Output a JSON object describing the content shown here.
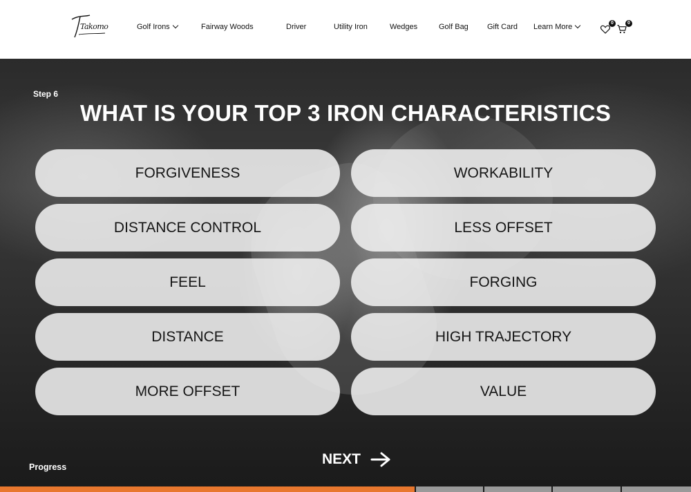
{
  "header": {
    "logo_text": "Takomo",
    "nav": [
      {
        "label": "Golf Irons",
        "dropdown": true
      },
      {
        "label": "Fairway Woods",
        "dropdown": false
      },
      {
        "label": "Driver",
        "dropdown": false
      },
      {
        "label": "Utility Iron",
        "dropdown": false
      },
      {
        "label": "Wedges",
        "dropdown": false
      },
      {
        "label": "Golf Bag",
        "dropdown": false
      },
      {
        "label": "Gift Card",
        "dropdown": false
      },
      {
        "label": "Learn More",
        "dropdown": true
      }
    ],
    "wishlist_count": "0",
    "cart_count": "0"
  },
  "quiz": {
    "step_label": "Step 6",
    "question": "WHAT IS YOUR TOP 3 IRON CHARACTERISTICS",
    "options": [
      "FORGIVENESS",
      "WORKABILITY",
      "DISTANCE CONTROL",
      "LESS OFFSET",
      "FEEL",
      "FORGING",
      "DISTANCE",
      "HIGH TRAJECTORY",
      "MORE OFFSET",
      "VALUE"
    ],
    "progress_label": "Progress",
    "next_label": "NEXT",
    "progress_fraction": 0.6
  },
  "colors": {
    "accent": "#e8772e",
    "progress_track": "#9a9a9a"
  }
}
